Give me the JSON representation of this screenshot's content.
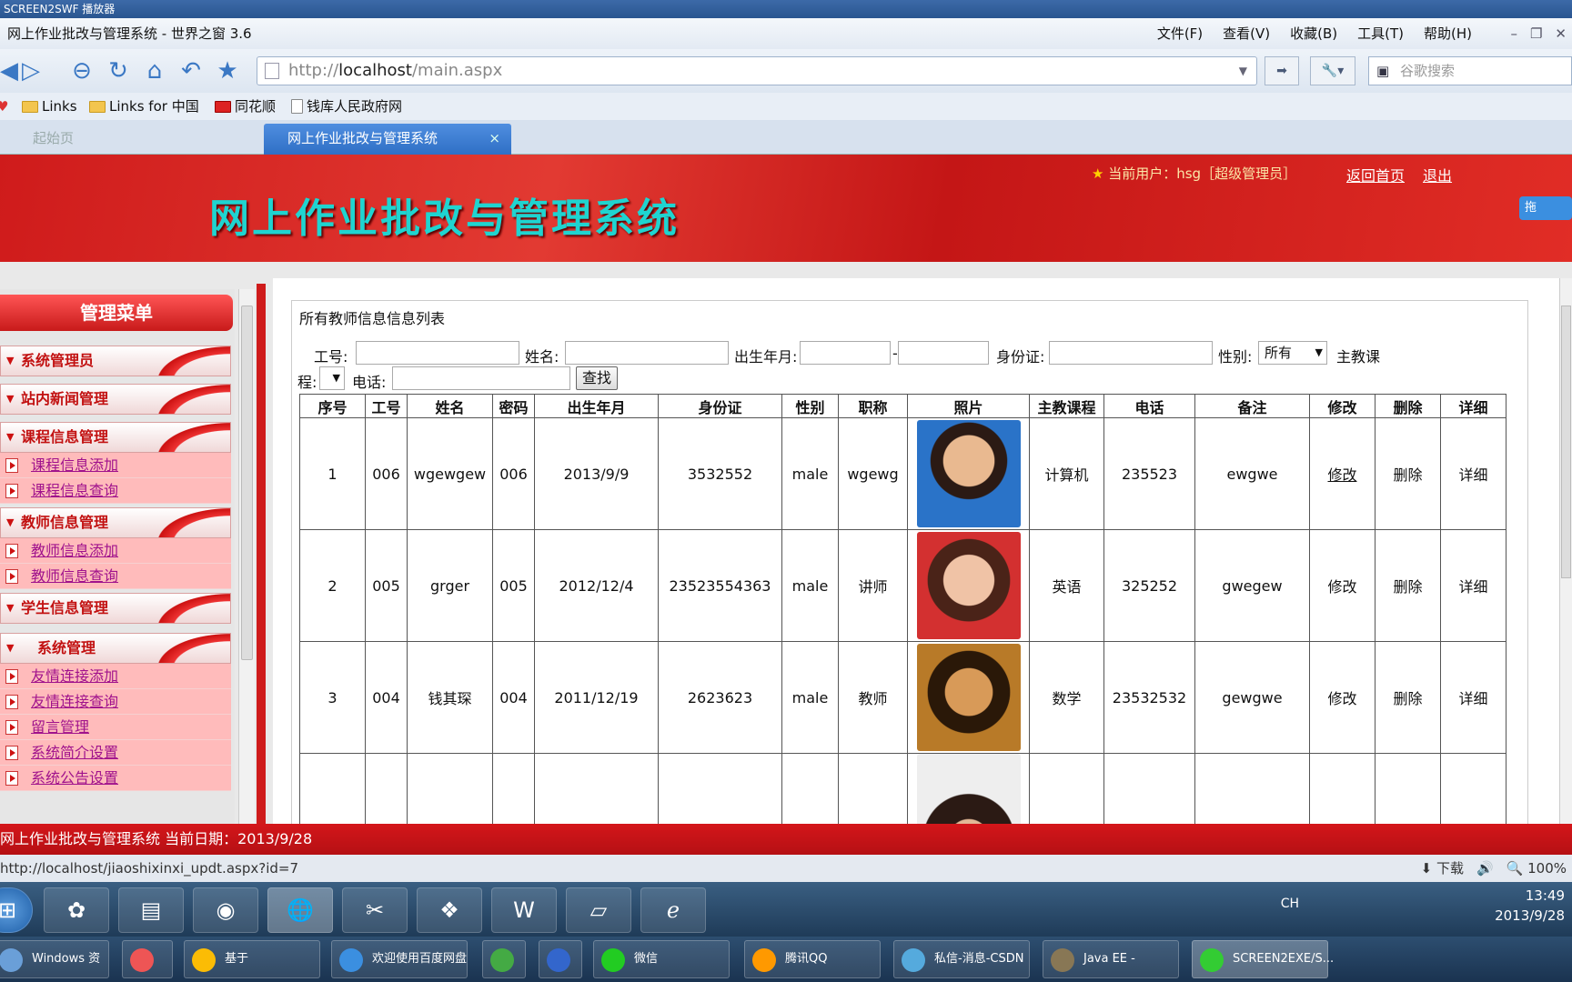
{
  "player": {
    "title": "SCREEN2SWF 播放器"
  },
  "browser": {
    "title": "网上作业批改与管理系统 - 世界之窗 3.6",
    "menu": [
      "文件(F)",
      "查看(V)",
      "收藏(B)",
      "工具(T)",
      "帮助(H)"
    ],
    "url_prefix": "http://",
    "url_host": "localhost",
    "url_path": "/main.aspx",
    "search_placeholder": "谷歌搜索",
    "favorites": [
      "Links",
      "Links for 中国",
      "同花顺",
      "钱库人民政府网"
    ],
    "tabs": [
      {
        "label": "起始页",
        "active": false
      },
      {
        "label": "网上作业批改与管理系统",
        "active": true
      }
    ],
    "tab_close": "×",
    "status_url": "http://localhost/jiaoshixinxi_updt.aspx?id=7",
    "status_download": "下载",
    "zoom": "100%"
  },
  "banner": {
    "system_title": "网上作业批改与管理系统",
    "current_user": "当前用户：hsg［超级管理员］",
    "home_link": "返回首页",
    "logout_link": "退出",
    "cloud_label": "拖"
  },
  "menu": {
    "heading": "管理菜单",
    "groups": [
      {
        "label": "系统管理员",
        "items": []
      },
      {
        "label": "站内新闻管理",
        "items": []
      },
      {
        "label": "课程信息管理",
        "items": [
          "课程信息添加",
          "课程信息查询"
        ]
      },
      {
        "label": "教师信息管理",
        "items": [
          "教师信息添加",
          "教师信息查询"
        ]
      },
      {
        "label": "学生信息管理",
        "items": []
      },
      {
        "label": "系统管理",
        "items": [
          "友情连接添加",
          "友情连接查询",
          "留言管理",
          "系统简介设置",
          "系统公告设置"
        ]
      }
    ]
  },
  "content": {
    "panel_title": "所有教师信息信息列表",
    "search": {
      "gonghao_label": "工号:",
      "name_label": "姓名:",
      "birth_label": "出生年月:",
      "birth_sep": "-",
      "idcard_label": "身份证:",
      "gender_label": "性别:",
      "gender_value": "所有",
      "course_label_a": "主教课",
      "course_label_b": "程:",
      "phone_label": "电话:",
      "search_button": "查找"
    },
    "columns": [
      "序号",
      "工号",
      "姓名",
      "密码",
      "出生年月",
      "身份证",
      "性别",
      "职称",
      "照片",
      "主教课程",
      "电话",
      "备注",
      "修改",
      "删除",
      "详细"
    ],
    "rows": [
      {
        "no": "1",
        "id": "006",
        "name": "wgewgew",
        "pwd": "006",
        "birth": "2013/9/9",
        "idcard": "3532552",
        "gender": "male",
        "title": "wgewg",
        "course": "计算机",
        "phone": "235523",
        "note": "ewgwe",
        "edit": "修改",
        "del": "删除",
        "detail": "详细"
      },
      {
        "no": "2",
        "id": "005",
        "name": "grger",
        "pwd": "005",
        "birth": "2012/12/4",
        "idcard": "23523554363",
        "gender": "male",
        "title": "讲师",
        "course": "英语",
        "phone": "325252",
        "note": "gwegew",
        "edit": "修改",
        "del": "删除",
        "detail": "详细"
      },
      {
        "no": "3",
        "id": "004",
        "name": "钱其琛",
        "pwd": "004",
        "birth": "2011/12/19",
        "idcard": "2623623",
        "gender": "male",
        "title": "教师",
        "course": "数学",
        "phone": "23532532",
        "note": "gewgwe",
        "edit": "修改",
        "del": "删除",
        "detail": "详细"
      }
    ]
  },
  "footer": {
    "text": "网上作业批改与管理系统  当前日期：2013/9/28"
  },
  "taskbar": {
    "tray_lang": "CH",
    "clock_time": "13:49",
    "clock_date": "2013/9/28",
    "windows": [
      "Windows 资源...",
      "基于Springboot...",
      "欢迎使用百度网盘",
      "微信",
      "腾讯QQ",
      "私信-消息-CSDN",
      "Java EE - Eclipse",
      "SCREEN2EXE/S..."
    ]
  },
  "colors": {
    "banner_red": "#cf1b1b",
    "title_cyan": "#1fd4d0",
    "menu_link": "#a0128c"
  }
}
